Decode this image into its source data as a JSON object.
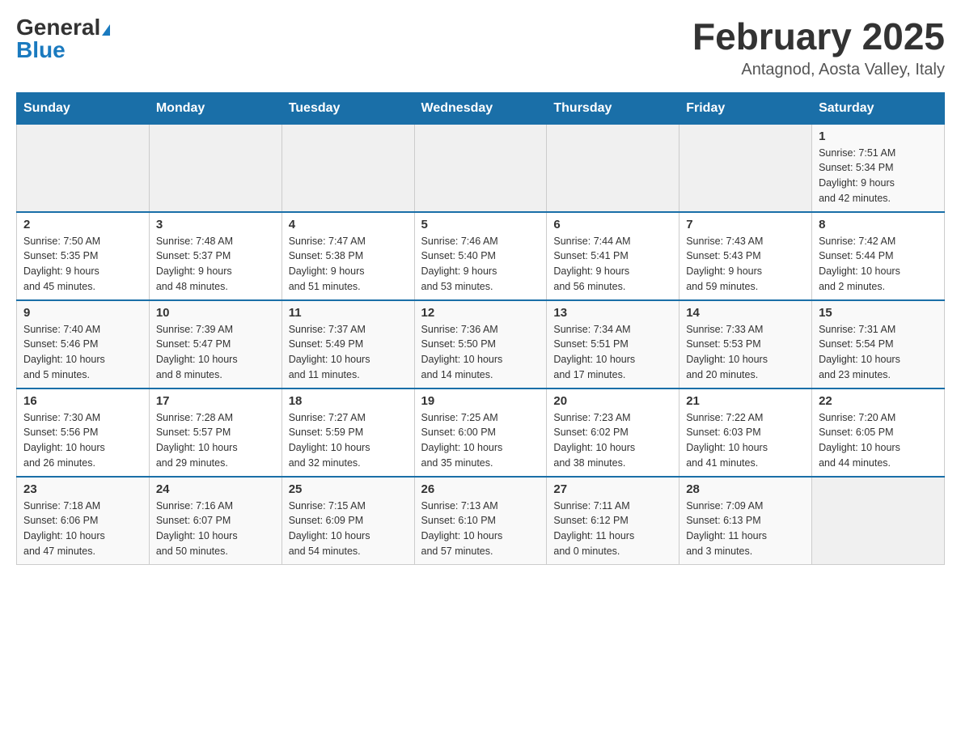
{
  "header": {
    "logo_general": "General",
    "logo_blue": "Blue",
    "month_title": "February 2025",
    "location": "Antagnod, Aosta Valley, Italy"
  },
  "weekdays": [
    "Sunday",
    "Monday",
    "Tuesday",
    "Wednesday",
    "Thursday",
    "Friday",
    "Saturday"
  ],
  "weeks": [
    [
      {
        "day": "",
        "info": ""
      },
      {
        "day": "",
        "info": ""
      },
      {
        "day": "",
        "info": ""
      },
      {
        "day": "",
        "info": ""
      },
      {
        "day": "",
        "info": ""
      },
      {
        "day": "",
        "info": ""
      },
      {
        "day": "1",
        "info": "Sunrise: 7:51 AM\nSunset: 5:34 PM\nDaylight: 9 hours\nand 42 minutes."
      }
    ],
    [
      {
        "day": "2",
        "info": "Sunrise: 7:50 AM\nSunset: 5:35 PM\nDaylight: 9 hours\nand 45 minutes."
      },
      {
        "day": "3",
        "info": "Sunrise: 7:48 AM\nSunset: 5:37 PM\nDaylight: 9 hours\nand 48 minutes."
      },
      {
        "day": "4",
        "info": "Sunrise: 7:47 AM\nSunset: 5:38 PM\nDaylight: 9 hours\nand 51 minutes."
      },
      {
        "day": "5",
        "info": "Sunrise: 7:46 AM\nSunset: 5:40 PM\nDaylight: 9 hours\nand 53 minutes."
      },
      {
        "day": "6",
        "info": "Sunrise: 7:44 AM\nSunset: 5:41 PM\nDaylight: 9 hours\nand 56 minutes."
      },
      {
        "day": "7",
        "info": "Sunrise: 7:43 AM\nSunset: 5:43 PM\nDaylight: 9 hours\nand 59 minutes."
      },
      {
        "day": "8",
        "info": "Sunrise: 7:42 AM\nSunset: 5:44 PM\nDaylight: 10 hours\nand 2 minutes."
      }
    ],
    [
      {
        "day": "9",
        "info": "Sunrise: 7:40 AM\nSunset: 5:46 PM\nDaylight: 10 hours\nand 5 minutes."
      },
      {
        "day": "10",
        "info": "Sunrise: 7:39 AM\nSunset: 5:47 PM\nDaylight: 10 hours\nand 8 minutes."
      },
      {
        "day": "11",
        "info": "Sunrise: 7:37 AM\nSunset: 5:49 PM\nDaylight: 10 hours\nand 11 minutes."
      },
      {
        "day": "12",
        "info": "Sunrise: 7:36 AM\nSunset: 5:50 PM\nDaylight: 10 hours\nand 14 minutes."
      },
      {
        "day": "13",
        "info": "Sunrise: 7:34 AM\nSunset: 5:51 PM\nDaylight: 10 hours\nand 17 minutes."
      },
      {
        "day": "14",
        "info": "Sunrise: 7:33 AM\nSunset: 5:53 PM\nDaylight: 10 hours\nand 20 minutes."
      },
      {
        "day": "15",
        "info": "Sunrise: 7:31 AM\nSunset: 5:54 PM\nDaylight: 10 hours\nand 23 minutes."
      }
    ],
    [
      {
        "day": "16",
        "info": "Sunrise: 7:30 AM\nSunset: 5:56 PM\nDaylight: 10 hours\nand 26 minutes."
      },
      {
        "day": "17",
        "info": "Sunrise: 7:28 AM\nSunset: 5:57 PM\nDaylight: 10 hours\nand 29 minutes."
      },
      {
        "day": "18",
        "info": "Sunrise: 7:27 AM\nSunset: 5:59 PM\nDaylight: 10 hours\nand 32 minutes."
      },
      {
        "day": "19",
        "info": "Sunrise: 7:25 AM\nSunset: 6:00 PM\nDaylight: 10 hours\nand 35 minutes."
      },
      {
        "day": "20",
        "info": "Sunrise: 7:23 AM\nSunset: 6:02 PM\nDaylight: 10 hours\nand 38 minutes."
      },
      {
        "day": "21",
        "info": "Sunrise: 7:22 AM\nSunset: 6:03 PM\nDaylight: 10 hours\nand 41 minutes."
      },
      {
        "day": "22",
        "info": "Sunrise: 7:20 AM\nSunset: 6:05 PM\nDaylight: 10 hours\nand 44 minutes."
      }
    ],
    [
      {
        "day": "23",
        "info": "Sunrise: 7:18 AM\nSunset: 6:06 PM\nDaylight: 10 hours\nand 47 minutes."
      },
      {
        "day": "24",
        "info": "Sunrise: 7:16 AM\nSunset: 6:07 PM\nDaylight: 10 hours\nand 50 minutes."
      },
      {
        "day": "25",
        "info": "Sunrise: 7:15 AM\nSunset: 6:09 PM\nDaylight: 10 hours\nand 54 minutes."
      },
      {
        "day": "26",
        "info": "Sunrise: 7:13 AM\nSunset: 6:10 PM\nDaylight: 10 hours\nand 57 minutes."
      },
      {
        "day": "27",
        "info": "Sunrise: 7:11 AM\nSunset: 6:12 PM\nDaylight: 11 hours\nand 0 minutes."
      },
      {
        "day": "28",
        "info": "Sunrise: 7:09 AM\nSunset: 6:13 PM\nDaylight: 11 hours\nand 3 minutes."
      },
      {
        "day": "",
        "info": ""
      }
    ]
  ]
}
